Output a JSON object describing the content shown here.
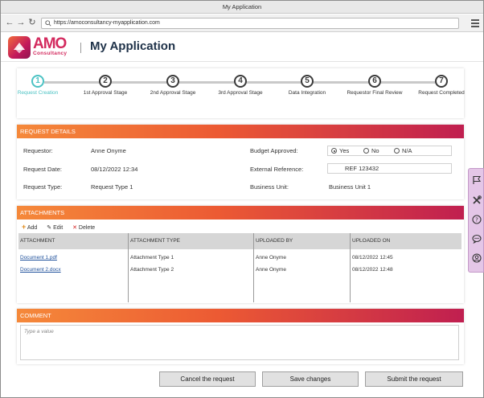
{
  "browser": {
    "window_title": "My Application",
    "url": "https://amoconsultancy-myapplication.com"
  },
  "header": {
    "logo_text": "AMO",
    "logo_sub": "Consultancy",
    "app_title": "My Application"
  },
  "stepper": {
    "active_index": 0,
    "steps": [
      {
        "number": "1",
        "label": "Request Creation"
      },
      {
        "number": "2",
        "label": "1st Approval Stage"
      },
      {
        "number": "3",
        "label": "2nd Approval Stage"
      },
      {
        "number": "4",
        "label": "3rd Approval Stage"
      },
      {
        "number": "5",
        "label": "Data Integration"
      },
      {
        "number": "6",
        "label": "Requestor Final Review"
      },
      {
        "number": "7",
        "label": "Request Completed"
      }
    ]
  },
  "request_details": {
    "heading": "REQUEST DETAILS",
    "requestor_label": "Requestor:",
    "requestor_value": "Anne Onyme",
    "request_date_label": "Request Date:",
    "request_date_value": "08/12/2022 12:34",
    "request_type_label": "Request Type:",
    "request_type_value": "Request Type 1",
    "budget_label": "Budget Approved:",
    "budget_options": [
      "Yes",
      "No",
      "N/A"
    ],
    "budget_selected": "Yes",
    "external_ref_label": "External Reference:",
    "external_ref_value": "REF 123432",
    "business_unit_label": "Business Unit:",
    "business_unit_value": "Business Unit 1"
  },
  "attachments": {
    "heading": "ATTACHMENTS",
    "toolbar": {
      "add": "Add",
      "edit": "Edit",
      "delete": "Delete"
    },
    "columns": [
      "ATTACHMENT",
      "ATTACHMENT TYPE",
      "UPLOADED BY",
      "UPLOADED ON"
    ],
    "rows": [
      {
        "name": "Document 1.pdf",
        "type": "Attachment Type 1",
        "by": "Anne Onyme",
        "on": "08/12/2022 12:45"
      },
      {
        "name": "Document 2.docx",
        "type": "Attachment Type 2",
        "by": "Anne Onyme",
        "on": "08/12/2022 12:48"
      }
    ]
  },
  "comment": {
    "heading": "COMMENT",
    "placeholder": "Type a value"
  },
  "actions": {
    "cancel": "Cancel the request",
    "save": "Save changes",
    "submit": "Submit the request"
  },
  "side_panel": {
    "icons": [
      "flag-icon",
      "tools-icon",
      "help-icon",
      "chat-icon",
      "user-icon"
    ]
  },
  "colors": {
    "accent_teal": "#4bc2c3",
    "gradient_start": "#f5893a",
    "gradient_end": "#c01f50",
    "title_navy": "#1e3148"
  }
}
